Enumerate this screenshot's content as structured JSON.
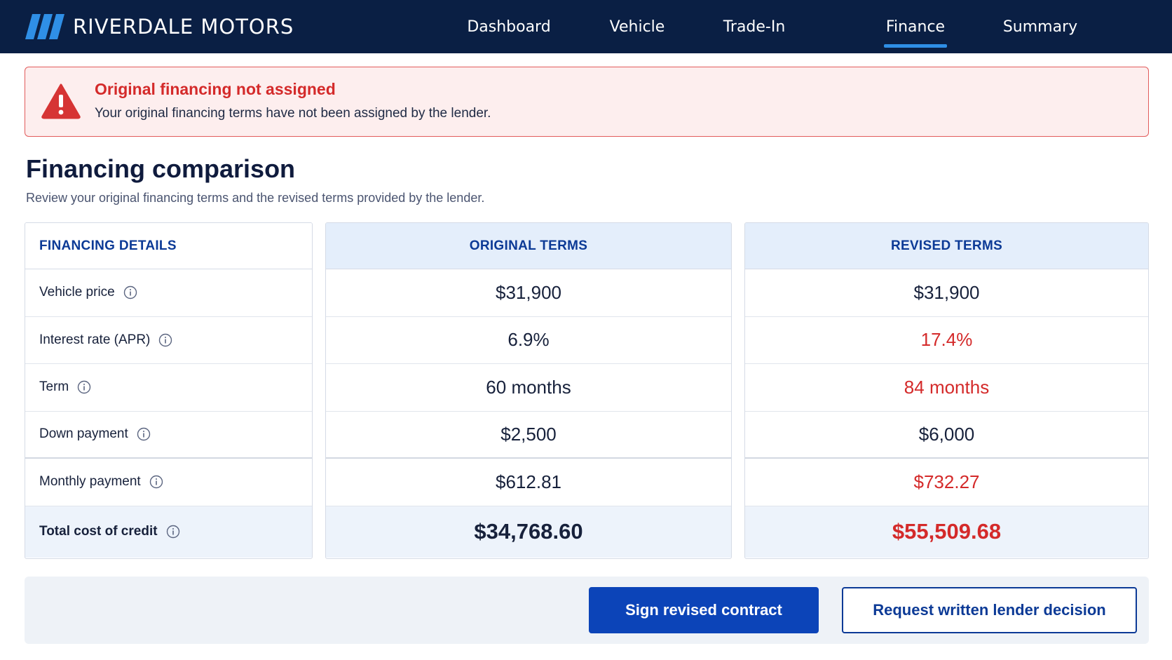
{
  "header": {
    "brand_name": "RIVERDALE MOTORS",
    "logo_icon": "stripes-logo-icon",
    "nav": [
      {
        "label": "Dashboard",
        "active": false
      },
      {
        "label": "Vehicle",
        "active": false
      },
      {
        "label": "Trade-In",
        "active": false
      },
      {
        "label": "Finance",
        "active": true
      },
      {
        "label": "Summary",
        "active": false
      }
    ]
  },
  "alert": {
    "icon": "warning-icon",
    "title": "Original financing not assigned",
    "message": "Your original financing terms have not been assigned by the lender."
  },
  "page": {
    "title": "Financing comparison",
    "subtitle": "Review your original financing terms and the revised terms provided by the lender."
  },
  "table": {
    "headers": {
      "details": "FINANCING DETAILS",
      "original": "ORIGINAL TERMS",
      "revised": "REVISED TERMS"
    },
    "rows": [
      {
        "label": "Vehicle price",
        "original": "$31,900",
        "revised": "$31,900",
        "revised_changed": false
      },
      {
        "label": "Interest rate (APR)",
        "original": "6.9%",
        "revised": "17.4%",
        "revised_changed": true
      },
      {
        "label": "Term",
        "original": "60 months",
        "revised": "84 months",
        "revised_changed": true
      },
      {
        "label": "Down payment",
        "original": "$2,500",
        "revised": "$6,000",
        "revised_changed": false
      },
      {
        "label": "Monthly payment",
        "original": "$612.81",
        "revised": "$732.27",
        "revised_changed": true
      },
      {
        "label": "Total cost of credit",
        "original": "$34,768.60",
        "revised": "$55,509.68",
        "revised_changed": true
      }
    ]
  },
  "actions": {
    "sign_label": "Sign revised contract",
    "request_label": "Request written lender decision"
  },
  "colors": {
    "header_bg": "#0a1f44",
    "accent_blue": "#0c44b8",
    "alert_red": "#d42a2a",
    "nav_underline": "#2f8fe6"
  }
}
